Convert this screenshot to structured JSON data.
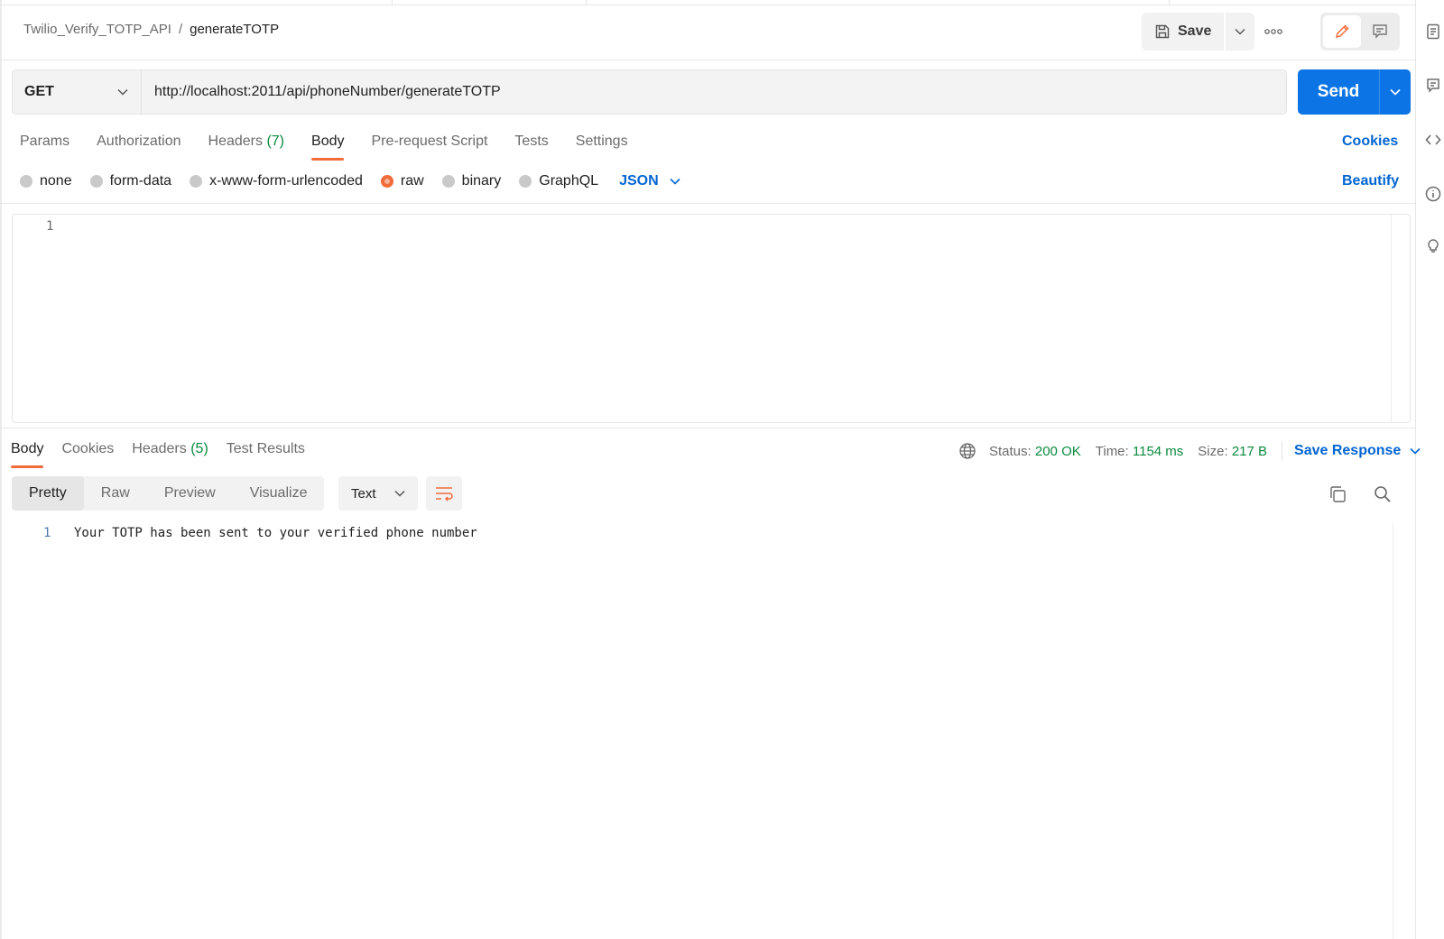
{
  "header": {
    "collection": "Twilio_Verify_TOTP_API",
    "separator": "/",
    "request_name": "generateTOTP",
    "save_label": "Save"
  },
  "request": {
    "method": "GET",
    "url": "http://localhost:2011/api/phoneNumber/generateTOTP",
    "send_label": "Send"
  },
  "request_tabs": [
    {
      "label": "Params",
      "count": "",
      "active": false
    },
    {
      "label": "Authorization",
      "count": "",
      "active": false
    },
    {
      "label": "Headers",
      "count": "(7)",
      "active": false
    },
    {
      "label": "Body",
      "count": "",
      "active": true
    },
    {
      "label": "Pre-request Script",
      "count": "",
      "active": false
    },
    {
      "label": "Tests",
      "count": "",
      "active": false
    },
    {
      "label": "Settings",
      "count": "",
      "active": false
    }
  ],
  "cookies_label": "Cookies",
  "body_types": [
    {
      "label": "none",
      "selected": false
    },
    {
      "label": "form-data",
      "selected": false
    },
    {
      "label": "x-www-form-urlencoded",
      "selected": false
    },
    {
      "label": "raw",
      "selected": true
    },
    {
      "label": "binary",
      "selected": false
    },
    {
      "label": "GraphQL",
      "selected": false
    }
  ],
  "raw_format": "JSON",
  "beautify_label": "Beautify",
  "editor": {
    "line_number": "1"
  },
  "response_tabs": [
    {
      "label": "Body",
      "count": "",
      "active": true
    },
    {
      "label": "Cookies",
      "count": "",
      "active": false
    },
    {
      "label": "Headers",
      "count": "(5)",
      "active": false
    },
    {
      "label": "Test Results",
      "count": "",
      "active": false
    }
  ],
  "response_meta": {
    "status_label": "Status:",
    "status_value": "200 OK",
    "time_label": "Time:",
    "time_value": "1154 ms",
    "size_label": "Size:",
    "size_value": "217 B",
    "save_response_label": "Save Response"
  },
  "format_tabs": [
    {
      "label": "Pretty",
      "active": true
    },
    {
      "label": "Raw",
      "active": false
    },
    {
      "label": "Preview",
      "active": false
    },
    {
      "label": "Visualize",
      "active": false
    }
  ],
  "text_format": "Text",
  "response_body": {
    "line_number": "1",
    "text": "Your TOTP has been sent to your verified phone number"
  },
  "colors": {
    "accent": "#f26b3a",
    "send_blue": "#0c74e4",
    "link_blue": "#0265d2",
    "success_green": "#0b8a3e"
  }
}
